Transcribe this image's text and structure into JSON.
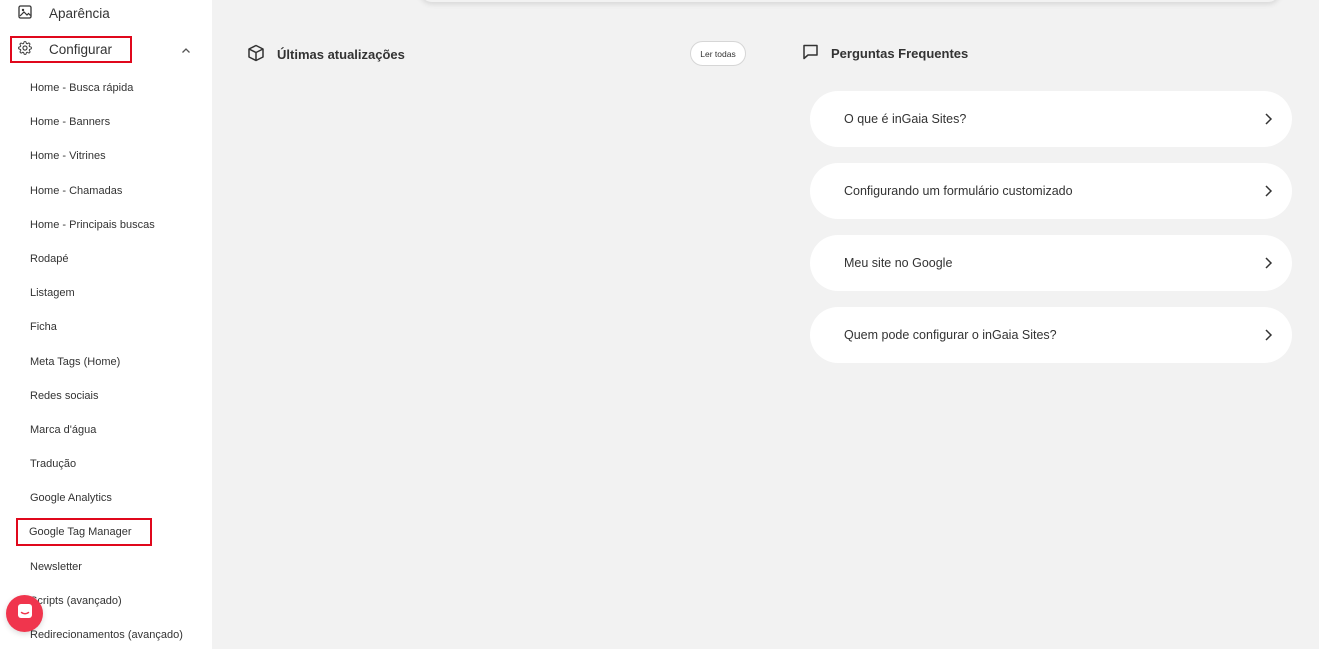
{
  "sidebar": {
    "top_item": {
      "label": "Aparência",
      "icon": "image-icon"
    },
    "config_item": {
      "label": "Configurar",
      "icon": "gear-icon"
    },
    "submenu": [
      {
        "label": "Home - Busca rápida"
      },
      {
        "label": "Home - Banners"
      },
      {
        "label": "Home - Vitrines"
      },
      {
        "label": "Home - Chamadas"
      },
      {
        "label": "Home - Principais buscas"
      },
      {
        "label": "Rodapé"
      },
      {
        "label": "Listagem"
      },
      {
        "label": "Ficha"
      },
      {
        "label": "Meta Tags (Home)"
      },
      {
        "label": "Redes sociais"
      },
      {
        "label": "Marca d'água"
      },
      {
        "label": "Tradução"
      },
      {
        "label": "Google Analytics"
      },
      {
        "label": "Google Tag Manager"
      },
      {
        "label": "Newsletter"
      },
      {
        "label": "Scripts (avançado)"
      },
      {
        "label": "Redirecionamentos (avançado)"
      }
    ],
    "highlight_color": "#e0081c"
  },
  "updates": {
    "title": "Últimas atualizações",
    "icon": "box-icon",
    "read_all_label": "Ler todas"
  },
  "faq": {
    "title": "Perguntas Frequentes",
    "icon": "chat-icon",
    "items": [
      {
        "label": "O que é inGaia Sites?"
      },
      {
        "label": "Configurando um formulário customizado"
      },
      {
        "label": "Meu site no Google"
      },
      {
        "label": "Quem pode configurar o inGaia Sites?"
      }
    ]
  },
  "chat_widget": {
    "icon": "chat-widget-icon",
    "color": "#f0354d"
  }
}
